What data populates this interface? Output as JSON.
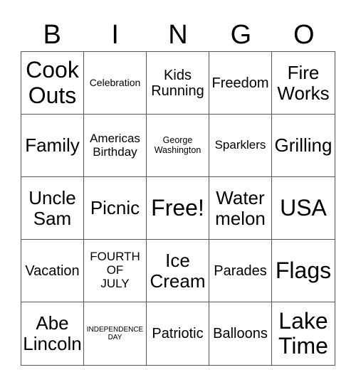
{
  "header": [
    "B",
    "I",
    "N",
    "G",
    "O"
  ],
  "cells": [
    {
      "text": "Cook\nOuts",
      "size": "s-xl"
    },
    {
      "text": "Celebration",
      "size": "s-s"
    },
    {
      "text": "Kids\nRunning",
      "size": "s-m"
    },
    {
      "text": "Freedom",
      "size": "s-m"
    },
    {
      "text": "Fire\nWorks",
      "size": "s-l"
    },
    {
      "text": "Family",
      "size": "s-l"
    },
    {
      "text": "Americas\nBirthday",
      "size": "s-ms"
    },
    {
      "text": "George\nWashington",
      "size": "s-xs"
    },
    {
      "text": "Sparklers",
      "size": "s-ms"
    },
    {
      "text": "Grilling",
      "size": "s-l"
    },
    {
      "text": "Uncle\nSam",
      "size": "s-l"
    },
    {
      "text": "Picnic",
      "size": "s-l"
    },
    {
      "text": "Free!",
      "size": "s-xl"
    },
    {
      "text": "Water\nmelon",
      "size": "s-l"
    },
    {
      "text": "USA",
      "size": "s-xl"
    },
    {
      "text": "Vacation",
      "size": "s-m"
    },
    {
      "text": "FOURTH\nOF\nJULY",
      "size": "s-ms"
    },
    {
      "text": "Ice\nCream",
      "size": "s-l"
    },
    {
      "text": "Parades",
      "size": "s-m"
    },
    {
      "text": "Flags",
      "size": "s-xl"
    },
    {
      "text": "Abe\nLincoln",
      "size": "s-l"
    },
    {
      "text": "INDEPENDENCE\nDAY",
      "size": "s-xxs"
    },
    {
      "text": "Patriotic",
      "size": "s-m"
    },
    {
      "text": "Balloons",
      "size": "s-m"
    },
    {
      "text": "Lake\nTime",
      "size": "s-xl"
    }
  ]
}
